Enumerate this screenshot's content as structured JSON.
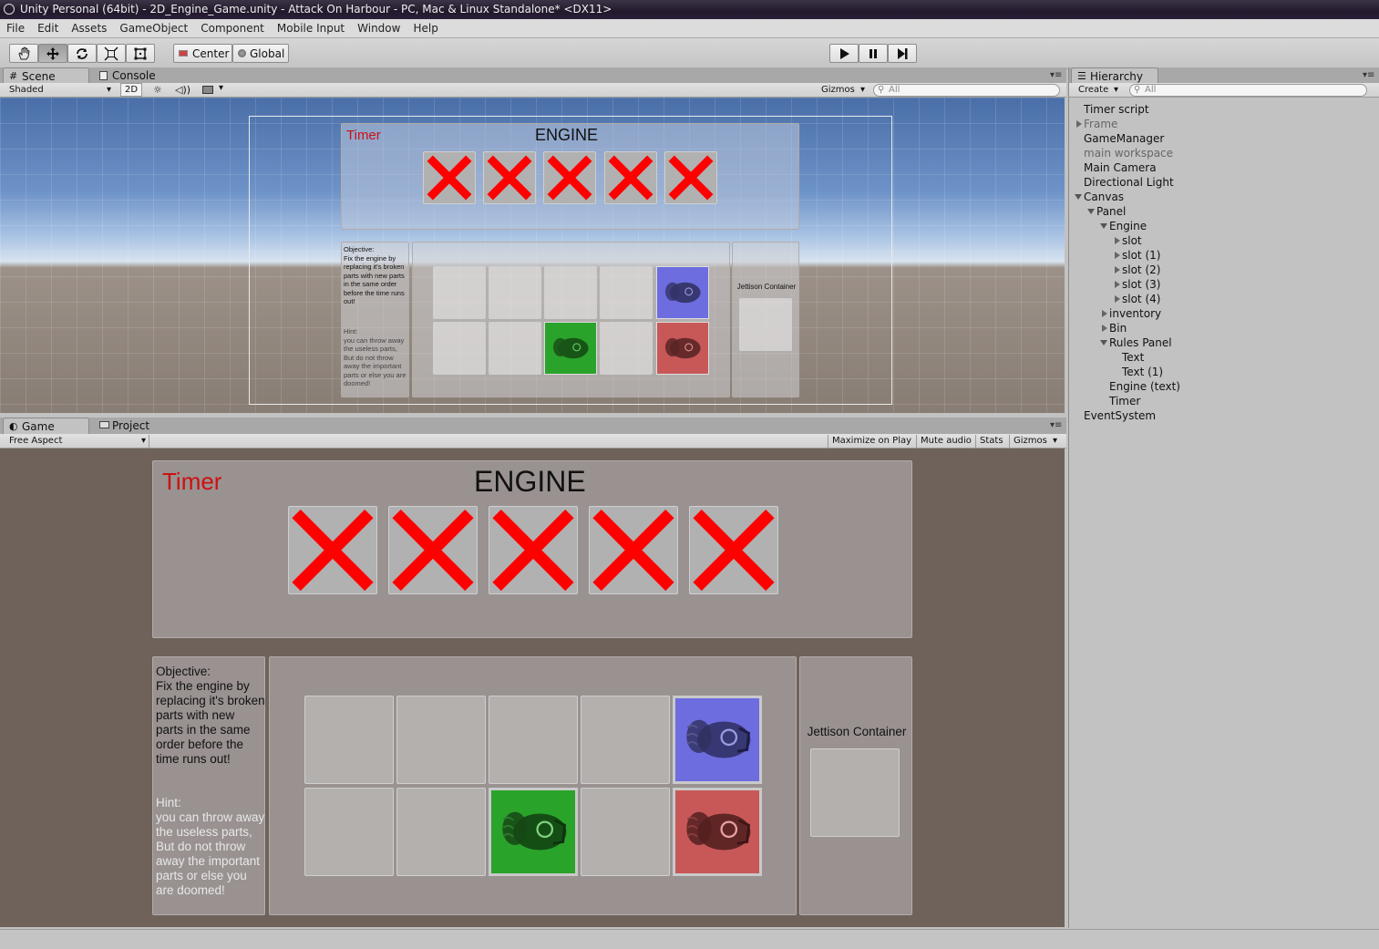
{
  "window": {
    "title": "Unity Personal (64bit) - 2D_Engine_Game.unity - Attack On Harbour - PC, Mac & Linux Standalone* <DX11>"
  },
  "menu": [
    "File",
    "Edit",
    "Assets",
    "GameObject",
    "Component",
    "Mobile Input",
    "Window",
    "Help"
  ],
  "toolbar": {
    "tools": [
      "hand-tool",
      "move-tool",
      "rotate-tool",
      "scale-tool",
      "rect-tool"
    ],
    "pivot_label": "Center",
    "space_label": "Global"
  },
  "scene_panel": {
    "tabs": [
      "Scene",
      "Console"
    ],
    "shading": "Shaded",
    "mode_2d": "2D",
    "gizmos_label": "Gizmos",
    "search_placeholder": "All"
  },
  "game_panel": {
    "tabs": [
      "Game",
      "Project"
    ],
    "aspect": "Free Aspect",
    "options": [
      "Maximize on Play",
      "Mute audio",
      "Stats",
      "Gizmos"
    ]
  },
  "game_ui": {
    "timer_label": "Timer",
    "engine_title": "ENGINE",
    "objective_heading": "Objective:",
    "objective_text": "Fix the engine by replacing it's broken parts with new parts in the same order before the time runs out!",
    "hint_heading": "Hint:",
    "hint_text": "you can throw away the useless parts, But do not throw away the important parts or else you are doomed!",
    "jettison_label": "Jettison Container",
    "engine_slot_states": [
      "broken",
      "broken",
      "broken",
      "broken",
      "broken"
    ],
    "inventory": [
      [
        "empty",
        "empty",
        "empty",
        "empty",
        "blue-part"
      ],
      [
        "empty",
        "empty",
        "green-part",
        "empty",
        "red-part"
      ]
    ],
    "colors": {
      "timer": "#cc1111",
      "x_mark": "#ff0000",
      "blue_part": "#6d6de0",
      "green_part": "#2aa32a",
      "red_part": "#c85858"
    }
  },
  "hierarchy": {
    "tab_label": "Hierarchy",
    "create_label": "Create",
    "search_placeholder": "All",
    "items": [
      {
        "label": "Timer script",
        "depth": 0,
        "arrow": "none",
        "dim": false
      },
      {
        "label": "Frame",
        "depth": 0,
        "arrow": "right",
        "dim": true
      },
      {
        "label": "GameManager",
        "depth": 0,
        "arrow": "none",
        "dim": false
      },
      {
        "label": "main workspace",
        "depth": 0,
        "arrow": "none",
        "dim": true
      },
      {
        "label": "Main Camera",
        "depth": 0,
        "arrow": "none",
        "dim": false
      },
      {
        "label": "Directional Light",
        "depth": 0,
        "arrow": "none",
        "dim": false
      },
      {
        "label": "Canvas",
        "depth": 0,
        "arrow": "down",
        "dim": false
      },
      {
        "label": "Panel",
        "depth": 1,
        "arrow": "down",
        "dim": false
      },
      {
        "label": "Engine",
        "depth": 2,
        "arrow": "down",
        "dim": false
      },
      {
        "label": "slot",
        "depth": 3,
        "arrow": "right",
        "dim": false
      },
      {
        "label": "slot (1)",
        "depth": 3,
        "arrow": "right",
        "dim": false
      },
      {
        "label": "slot (2)",
        "depth": 3,
        "arrow": "right",
        "dim": false
      },
      {
        "label": "slot (3)",
        "depth": 3,
        "arrow": "right",
        "dim": false
      },
      {
        "label": "slot (4)",
        "depth": 3,
        "arrow": "right",
        "dim": false
      },
      {
        "label": "inventory",
        "depth": 2,
        "arrow": "right",
        "dim": false
      },
      {
        "label": "Bin",
        "depth": 2,
        "arrow": "right",
        "dim": false
      },
      {
        "label": "Rules Panel",
        "depth": 2,
        "arrow": "down",
        "dim": false
      },
      {
        "label": "Text",
        "depth": 3,
        "arrow": "none",
        "dim": false
      },
      {
        "label": "Text (1)",
        "depth": 3,
        "arrow": "none",
        "dim": false
      },
      {
        "label": "Engine (text)",
        "depth": 2,
        "arrow": "none",
        "dim": false
      },
      {
        "label": "Timer",
        "depth": 2,
        "arrow": "none",
        "dim": false
      },
      {
        "label": "EventSystem",
        "depth": 0,
        "arrow": "none",
        "dim": false
      }
    ]
  }
}
